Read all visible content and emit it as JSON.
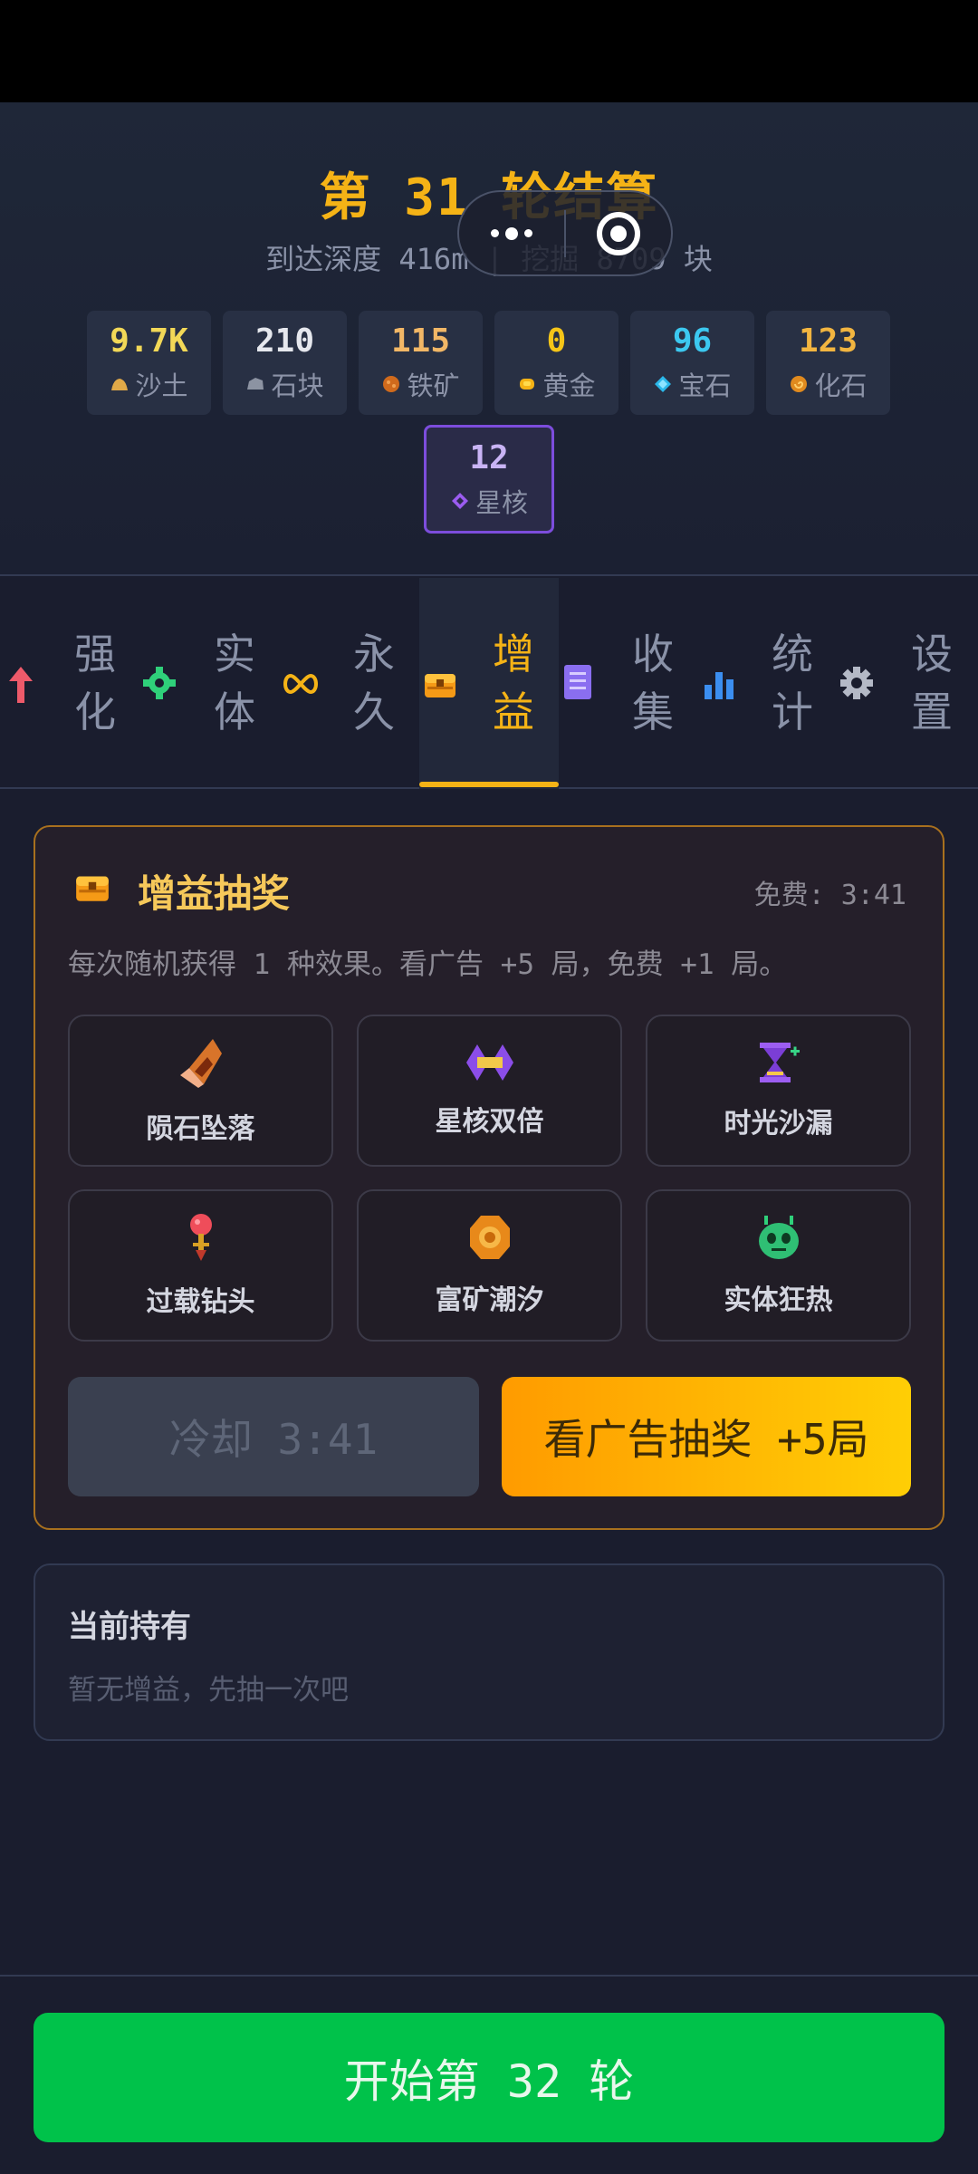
{
  "header": {
    "title": "第 31 轮结算",
    "subtitle": "到达深度 416m | 挖掘 8709 块"
  },
  "resources": [
    {
      "value": "9.7K",
      "label": "沙土",
      "icon": "sand-icon",
      "color": "#f2d857"
    },
    {
      "value": "210",
      "label": "石块",
      "icon": "stone-icon",
      "color": "#e6e8ee"
    },
    {
      "value": "115",
      "label": "铁矿",
      "icon": "iron-ore-icon",
      "color": "#f2b766"
    },
    {
      "value": "0",
      "label": "黄金",
      "icon": "gold-icon",
      "color": "#f5c518"
    },
    {
      "value": "96",
      "label": "宝石",
      "icon": "gem-icon",
      "color": "#3cc8f0"
    },
    {
      "value": "123",
      "label": "化石",
      "icon": "fossil-icon",
      "color": "#f2b540"
    }
  ],
  "star_core": {
    "value": "12",
    "label": "星核",
    "icon": "star-core-icon",
    "color": "#c9b4f5"
  },
  "tabs": [
    {
      "label_top": "强",
      "label_bottom": "化",
      "icon": "upgrade-arrow-icon",
      "active": false
    },
    {
      "label_top": "实",
      "label_bottom": "体",
      "icon": "gear-entity-icon",
      "active": false
    },
    {
      "label_top": "永",
      "label_bottom": "久",
      "icon": "infinity-icon",
      "active": false
    },
    {
      "label_top": "增",
      "label_bottom": "益",
      "icon": "chest-icon",
      "active": true
    },
    {
      "label_top": "收",
      "label_bottom": "集",
      "icon": "book-icon",
      "active": false
    },
    {
      "label_top": "统",
      "label_bottom": "计",
      "icon": "bar-chart-icon",
      "active": false
    },
    {
      "label_top": "设",
      "label_bottom": "置",
      "icon": "settings-gear-icon",
      "active": false
    }
  ],
  "lottery": {
    "title": "增益抽奖",
    "timer": "免费: 3:41",
    "description": "每次随机获得 1 种效果。看广告 +5 局，免费 +1 局。",
    "boosts": [
      {
        "label": "陨石坠落",
        "icon": "meteor-icon"
      },
      {
        "label": "星核双倍",
        "icon": "double-core-icon"
      },
      {
        "label": "时光沙漏",
        "icon": "hourglass-icon"
      },
      {
        "label": "过载钻头",
        "icon": "drill-icon"
      },
      {
        "label": "富矿潮汐",
        "icon": "ore-tide-icon"
      },
      {
        "label": "实体狂热",
        "icon": "entity-frenzy-icon"
      }
    ],
    "cooldown_button": "冷却 3:41",
    "ad_button": "看广告抽奖 +5局"
  },
  "holding": {
    "title": "当前持有",
    "empty_text": "暂无增益，先抽一次吧"
  },
  "start_button": "开始第 32 轮"
}
